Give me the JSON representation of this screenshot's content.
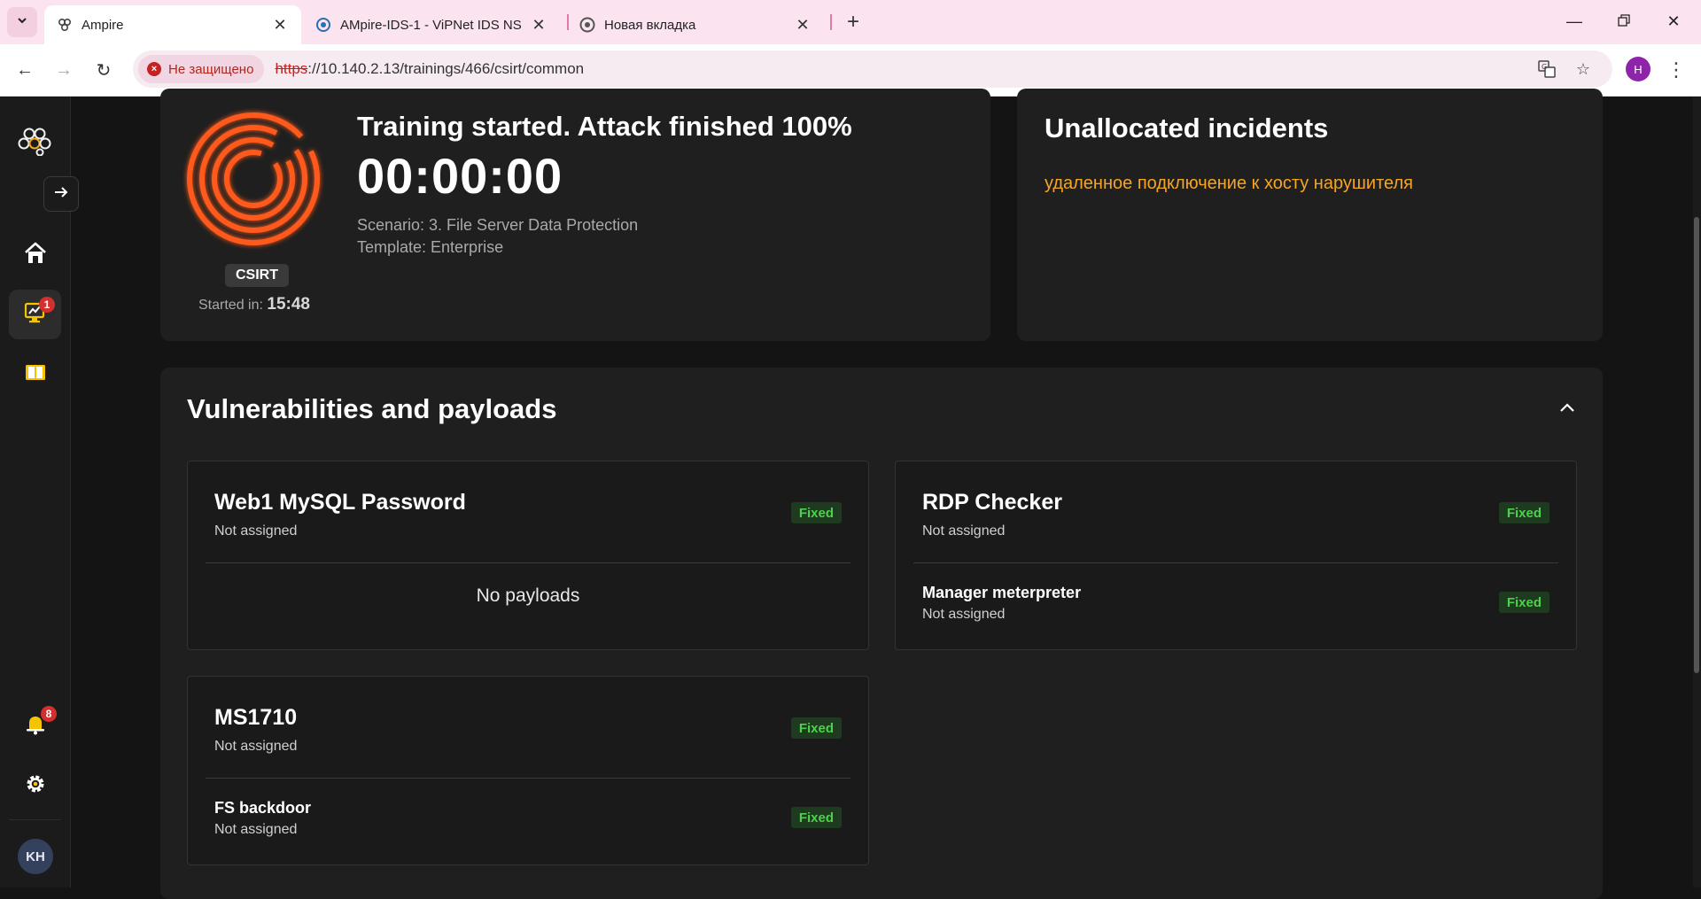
{
  "browser": {
    "tabs": [
      {
        "title": "Ampire",
        "active": true
      },
      {
        "title": "AMpire-IDS-1 - ViPNet IDS NS",
        "active": false
      },
      {
        "title": "Новая вкладка",
        "active": false
      }
    ],
    "security_label": "Не защищено",
    "url_scheme": "https",
    "url_rest": "://10.140.2.13/trainings/466/csirt/common",
    "profile_initial": "H"
  },
  "sidebar": {
    "training_badge": "1",
    "notifications_badge": "8",
    "user_initials": "KH"
  },
  "training": {
    "status": "Training started. Attack finished 100%",
    "timer": "00:00:00",
    "scenario": "Scenario: 3. File Server Data Protection",
    "template": "Template: Enterprise",
    "role_chip": "CSIRT",
    "started_label": "Started in:",
    "started_time": "15:48"
  },
  "incidents": {
    "title": "Unallocated incidents",
    "items": [
      "удаленное подключение к хосту нарушителя"
    ]
  },
  "vulnerabilities": {
    "title": "Vulnerabilities and payloads",
    "items": [
      {
        "name": "Web1 MySQL Password",
        "assignee": "Not assigned",
        "status": "Fixed",
        "empty_label": "No payloads"
      },
      {
        "name": "RDP Checker",
        "assignee": "Not assigned",
        "status": "Fixed",
        "payload": {
          "name": "Manager meterpreter",
          "assignee": "Not assigned",
          "status": "Fixed"
        }
      },
      {
        "name": "MS1710",
        "assignee": "Not assigned",
        "status": "Fixed",
        "payload": {
          "name": "FS backdoor",
          "assignee": "Not assigned",
          "status": "Fixed"
        }
      }
    ]
  },
  "colors": {
    "accent_orange": "#f5a623",
    "fixed_green": "#4cd14c",
    "badge_red": "#d32f2f",
    "logo_orange": "#ff5a1f"
  }
}
